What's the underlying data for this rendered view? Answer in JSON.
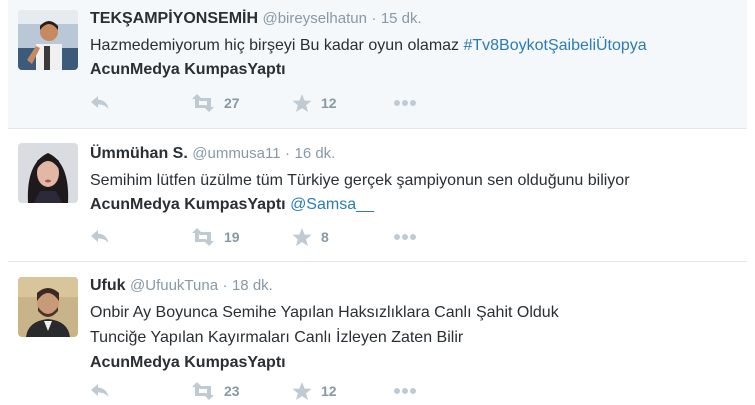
{
  "tweets": [
    {
      "fullname": "TEKŞAMPİYONSEMİH",
      "username": "@bireyselhatun",
      "separator": "·",
      "time": "15 dk.",
      "lines": [
        [
          {
            "text": "Hazmedemiyorum hiç birşeyi Bu kadar oyun olamaz ",
            "style": "plain"
          },
          {
            "text": "#Tv8BoykotŞaibeliÜtopya",
            "style": "link"
          }
        ],
        [
          {
            "text": "AcunMedya KumpasYaptı",
            "style": "bold"
          }
        ]
      ],
      "retweets": "27",
      "favorites": "12",
      "icons": {
        "reply": "reply-icon",
        "retweet": "retweet-icon",
        "favorite": "star-icon",
        "more": "more-icon"
      }
    },
    {
      "fullname": "Ümmühan S.",
      "username": "@ummusa11",
      "separator": "·",
      "time": "16 dk.",
      "lines": [
        [
          {
            "text": "Semihim lütfen üzülme tüm Türkiye gerçek şampiyonun sen olduğunu biliyor",
            "style": "plain"
          }
        ],
        [
          {
            "text": "AcunMedya KumpasYaptı",
            "style": "bold"
          },
          {
            "text": " ",
            "style": "plain"
          },
          {
            "text": "@Samsa__",
            "style": "link"
          }
        ]
      ],
      "retweets": "19",
      "favorites": "8",
      "icons": {
        "reply": "reply-icon",
        "retweet": "retweet-icon",
        "favorite": "star-icon",
        "more": "more-icon"
      }
    },
    {
      "fullname": "Ufuk",
      "username": "@UfuukTuna",
      "separator": "·",
      "time": "18 dk.",
      "lines": [
        [
          {
            "text": "Onbir Ay Boyunca Semihe Yapılan Haksızlıklara Canlı Şahit Olduk",
            "style": "plain"
          }
        ],
        [
          {
            "text": "Tunciğe Yapılan Kayırmaları Canlı İzleyen Zaten Bilir",
            "style": "plain"
          }
        ],
        [
          {
            "text": "AcunMedya KumpasYaptı",
            "style": "bold"
          }
        ]
      ],
      "retweets": "23",
      "favorites": "12",
      "icons": {
        "reply": "reply-icon",
        "retweet": "retweet-icon",
        "favorite": "star-icon",
        "more": "more-icon"
      }
    }
  ],
  "colors": {
    "name": "#292f33",
    "meta": "#8899a6",
    "link": "#2b7bb9",
    "action_icon": "#b0bcc5",
    "highlight_background": "#f5f8fa",
    "divider": "#e1e8ed"
  }
}
